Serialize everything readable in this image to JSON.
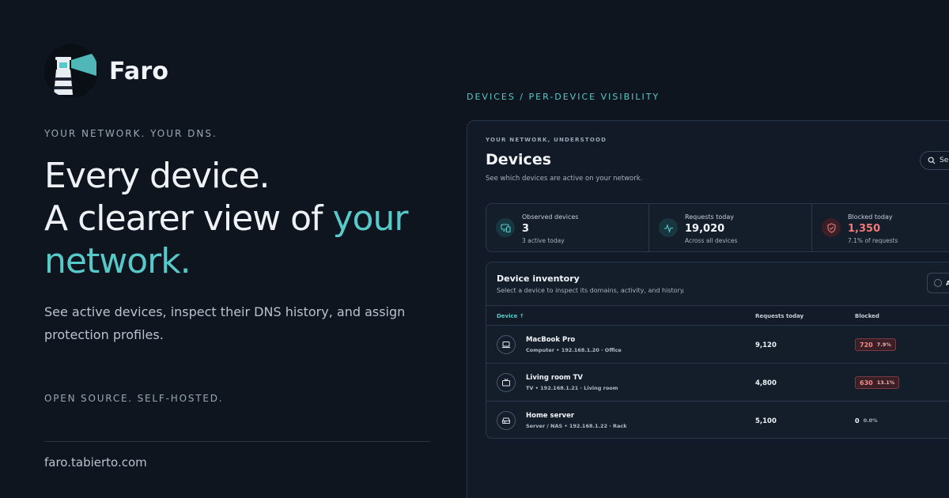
{
  "brand": {
    "name": "Faro"
  },
  "hero": {
    "eyebrow": "YOUR NETWORK. YOUR DNS.",
    "line1": "Every device.",
    "line2_prefix": "A clearer view of ",
    "line2_accent": "your",
    "line3_accent": "network.",
    "subtext": "See active devices, inspect their DNS history, and assign protection profiles.",
    "oss": "OPEN SOURCE. SELF-HOSTED.",
    "url": "faro.tabierto.com"
  },
  "section_label": "DEVICES / PER-DEVICE VISIBILITY",
  "panel": {
    "eyebrow": "YOUR NETWORK, UNDERSTOOD",
    "title": "Devices",
    "subtitle": "See which devices are active on your network.",
    "search_label": "Se",
    "stats": [
      {
        "label": "Observed devices",
        "value": "3",
        "note": "3 active today",
        "icon": "devices-icon",
        "color": "#58c9c9"
      },
      {
        "label": "Requests today",
        "value": "19,020",
        "note": "Across all devices",
        "icon": "activity-icon",
        "color": "#58c9c9"
      },
      {
        "label": "Blocked today",
        "value": "1,350",
        "note": "7.1% of requests",
        "icon": "shield-icon",
        "color": "#f07878"
      }
    ],
    "inventory": {
      "title": "Device inventory",
      "subtitle": "Select a device to inspect its domains, activity, and history.",
      "filter_label": "A",
      "columns": {
        "device": "Device ↑",
        "requests": "Requests today",
        "blocked": "Blocked"
      },
      "rows": [
        {
          "name": "MacBook Pro",
          "meta": "Computer  •  192.168.1.20 · Office",
          "requests": "9,120",
          "blocked": "720",
          "blocked_pct": "7.9%",
          "icon": "laptop-icon"
        },
        {
          "name": "Living room TV",
          "meta": "TV  •  192.168.1.21 · Living room",
          "requests": "4,800",
          "blocked": "630",
          "blocked_pct": "13.1%",
          "icon": "tv-icon"
        },
        {
          "name": "Home server",
          "meta": "Server / NAS  •  192.168.1.22 · Rack",
          "requests": "5,100",
          "blocked": "0",
          "blocked_pct": "0.0%",
          "icon": "server-icon"
        }
      ]
    }
  }
}
